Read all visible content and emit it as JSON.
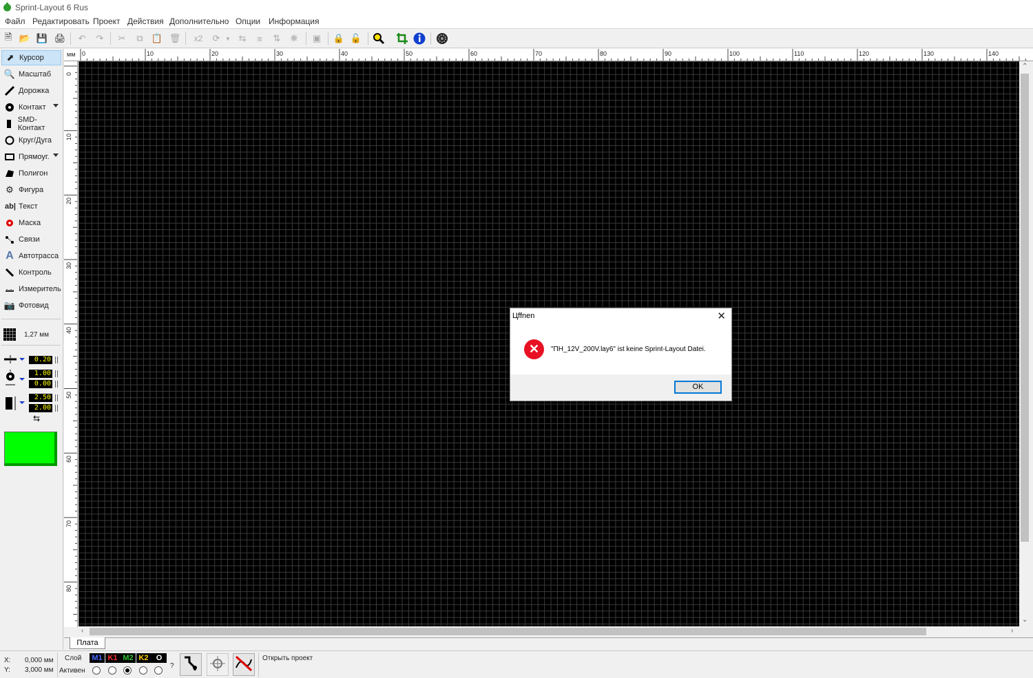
{
  "window": {
    "title": "Sprint-Layout 6 Rus"
  },
  "menu": [
    "Файл",
    "Редактировать",
    "Проект",
    "Действия",
    "Дополнительно",
    "Опции",
    "Информация"
  ],
  "toolbar": {
    "zoom_factor_label": "x2"
  },
  "tools": [
    {
      "label": "Курсор",
      "icon": "cursor-icon",
      "active": true
    },
    {
      "label": "Масштаб",
      "icon": "zoom-icon"
    },
    {
      "label": "Дорожка",
      "icon": "track-icon"
    },
    {
      "label": "Контакт",
      "icon": "pad-icon",
      "dropdown": true
    },
    {
      "label": "SMD-Контакт",
      "icon": "smd-pad-icon"
    },
    {
      "label": "Круг/Дуга",
      "icon": "circle-arc-icon"
    },
    {
      "label": "Прямоуг.",
      "icon": "rectangle-icon",
      "dropdown": true
    },
    {
      "label": "Полигон",
      "icon": "polygon-icon"
    },
    {
      "label": "Фигура",
      "icon": "shape-icon"
    },
    {
      "label": "Текст",
      "icon": "text-icon",
      "glyph": "ab|"
    },
    {
      "label": "Маска",
      "icon": "mask-icon"
    },
    {
      "label": "Связи",
      "icon": "connections-icon"
    },
    {
      "label": "Автотрасса",
      "icon": "autoroute-icon"
    },
    {
      "label": "Контроль",
      "icon": "control-icon"
    },
    {
      "label": "Измеритель",
      "icon": "measure-icon"
    },
    {
      "label": "Фотовид",
      "icon": "photoview-icon"
    }
  ],
  "grid": {
    "value": "1,27 мм"
  },
  "params": {
    "track_width": "0.20",
    "pad_outer": "1.00",
    "pad_inner": "0.00",
    "smd_width": "2.50",
    "smd_height": "2.00"
  },
  "colors": {
    "board_swatch": "#00ff00",
    "canvas_bg": "#000000",
    "grid_line": "#3a3a3a",
    "error": "#e81123"
  },
  "rulers": {
    "unit": "мм",
    "h_labels": [
      "0",
      "10",
      "20",
      "30",
      "40",
      "50",
      "60",
      "70",
      "80",
      "90",
      "100",
      "110",
      "120",
      "130",
      "140"
    ],
    "v_labels": [
      "0",
      "10",
      "20",
      "30",
      "40",
      "50",
      "60",
      "70",
      "80"
    ]
  },
  "tab": {
    "label": "Плата"
  },
  "status": {
    "x_label": "X:",
    "x_value": "0,000 мм",
    "y_label": "Y:",
    "y_value": "3,000 мм",
    "layer_label": "Слой",
    "active_label": "Активен",
    "layers": [
      {
        "name": "M1",
        "color": "#4a6cff"
      },
      {
        "name": "K1",
        "color": "#ff3030"
      },
      {
        "name": "M2",
        "color": "#30c030"
      },
      {
        "name": "K2",
        "color": "#ffd000"
      },
      {
        "name": "O",
        "color": "#ffffff"
      }
    ],
    "selected_layer_index": 2,
    "question": "?",
    "message": "Открыть проект"
  },
  "dialog": {
    "title": "Цffnen",
    "message": "\"ПН_12V_200V.lay6\" ist keine Sprint-Layout Datei.",
    "ok_label": "OK"
  }
}
